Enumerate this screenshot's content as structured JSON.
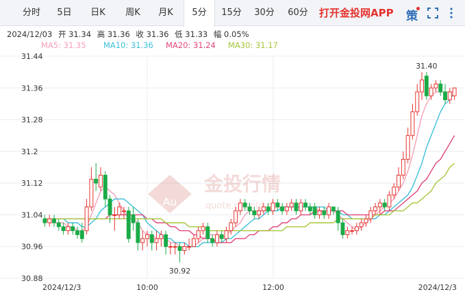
{
  "tabs": [
    {
      "label": "分时",
      "active": false
    },
    {
      "label": "5日",
      "active": false
    },
    {
      "label": "日K",
      "active": false
    },
    {
      "label": "周K",
      "active": false
    },
    {
      "label": "月K",
      "active": false
    },
    {
      "label": "5分",
      "active": true
    },
    {
      "label": "15分",
      "active": false
    },
    {
      "label": "30分",
      "active": false
    },
    {
      "label": "60分",
      "active": false
    }
  ],
  "app_link": "打开金投网APP",
  "toolbar": {
    "policy_label": "策"
  },
  "ohlc": {
    "date": "2024/12/03",
    "open": "开 31.34",
    "high": "高 31.36",
    "close": "收 31.36",
    "low": "低 31.33",
    "amplitude": "幅 0.05%"
  },
  "ma_legend": [
    {
      "label": "MA5: 31.35",
      "color": "#f5a0b8"
    },
    {
      "label": "MA10: 31.36",
      "color": "#3cbfd8"
    },
    {
      "label": "MA20: 31.24",
      "color": "#e0457b"
    },
    {
      "label": "MA30: 31.17",
      "color": "#a5c63b"
    }
  ],
  "colors": {
    "up": "#e5322d",
    "down": "#1bab47",
    "grid": "#e8ecf0"
  },
  "watermark": {
    "cn": "金投行情",
    "pinyin": "quote.cngold.org",
    "badge": "Au"
  },
  "chart_data": {
    "type": "candlestick",
    "title": "",
    "ylim": [
      30.88,
      31.44
    ],
    "y_ticks": [
      "31.44",
      "31.36",
      "31.28",
      "31.2",
      "31.12",
      "31.04",
      "30.96",
      "30.88"
    ],
    "x_labels": [
      "2024/12/3",
      "10:00",
      "12:00",
      "2024/12/3"
    ],
    "annotations": [
      {
        "text": "31.40",
        "index": 82,
        "value": 31.4
      },
      {
        "text": "30.92",
        "index": 29,
        "value": 30.92
      }
    ],
    "candles": [
      [
        31.03,
        31.02,
        31.04,
        31.01
      ],
      [
        31.02,
        31.03,
        31.04,
        31.01
      ],
      [
        31.03,
        31.02,
        31.04,
        31.01
      ],
      [
        31.02,
        31.01,
        31.03,
        31.0
      ],
      [
        31.01,
        31.0,
        31.02,
        30.99
      ],
      [
        31.0,
        31.01,
        31.02,
        30.99
      ],
      [
        31.01,
        31.0,
        31.02,
        30.99
      ],
      [
        31.0,
        30.99,
        31.01,
        30.98
      ],
      [
        31.0,
        30.98,
        31.02,
        30.97
      ],
      [
        31.0,
        31.06,
        31.08,
        30.99
      ],
      [
        31.06,
        31.13,
        31.16,
        31.05
      ],
      [
        31.13,
        31.12,
        31.17,
        31.1
      ],
      [
        31.11,
        31.14,
        31.16,
        31.1
      ],
      [
        31.14,
        31.08,
        31.15,
        31.06
      ],
      [
        31.08,
        31.04,
        31.09,
        31.02
      ],
      [
        31.04,
        31.04,
        31.06,
        31.0
      ],
      [
        31.04,
        31.06,
        31.07,
        31.03
      ],
      [
        31.05,
        31.05,
        31.06,
        31.03
      ],
      [
        31.05,
        30.98,
        31.06,
        30.97
      ],
      [
        31.04,
        31.02,
        31.06,
        31.0
      ],
      [
        31.02,
        30.97,
        31.03,
        30.95
      ],
      [
        30.97,
        30.98,
        31.0,
        30.95
      ],
      [
        30.98,
        30.99,
        31.0,
        30.96
      ],
      [
        30.99,
        30.97,
        31.0,
        30.95
      ],
      [
        30.97,
        30.98,
        31.0,
        30.95
      ],
      [
        30.98,
        30.99,
        31.0,
        30.96
      ],
      [
        30.99,
        30.96,
        31.0,
        30.94
      ],
      [
        30.96,
        30.96,
        30.97,
        30.94
      ],
      [
        30.96,
        30.96,
        30.97,
        30.94
      ],
      [
        30.96,
        30.95,
        30.97,
        30.92
      ],
      [
        30.95,
        30.96,
        30.97,
        30.94
      ],
      [
        30.96,
        30.96,
        30.98,
        30.95
      ],
      [
        30.96,
        30.98,
        30.99,
        30.96
      ],
      [
        30.98,
        31.0,
        31.01,
        30.97
      ],
      [
        31.0,
        31.01,
        31.02,
        30.99
      ],
      [
        31.01,
        30.98,
        31.02,
        30.97
      ],
      [
        30.98,
        30.97,
        30.99,
        30.96
      ],
      [
        30.97,
        30.99,
        31.0,
        30.96
      ],
      [
        30.99,
        30.98,
        31.0,
        30.97
      ],
      [
        30.98,
        31.0,
        31.01,
        30.97
      ],
      [
        31.0,
        31.02,
        31.03,
        30.99
      ],
      [
        31.02,
        31.05,
        31.06,
        31.01
      ],
      [
        31.05,
        31.07,
        31.08,
        31.04
      ],
      [
        31.07,
        31.06,
        31.08,
        31.05
      ],
      [
        31.06,
        31.05,
        31.07,
        31.04
      ],
      [
        31.05,
        31.04,
        31.06,
        31.03
      ],
      [
        31.04,
        31.05,
        31.06,
        31.03
      ],
      [
        31.05,
        31.06,
        31.07,
        31.04
      ],
      [
        31.06,
        31.05,
        31.07,
        31.04
      ],
      [
        31.05,
        31.07,
        31.08,
        31.04
      ],
      [
        31.07,
        31.06,
        31.08,
        31.05
      ],
      [
        31.06,
        31.05,
        31.07,
        31.04
      ],
      [
        31.05,
        31.06,
        31.07,
        31.04
      ],
      [
        31.06,
        31.07,
        31.08,
        31.05
      ],
      [
        31.07,
        31.05,
        31.08,
        31.04
      ],
      [
        31.05,
        31.07,
        31.08,
        31.04
      ],
      [
        31.07,
        31.06,
        31.08,
        31.05
      ],
      [
        31.06,
        31.05,
        31.07,
        31.04
      ],
      [
        31.06,
        31.04,
        31.07,
        31.03
      ],
      [
        31.04,
        31.05,
        31.06,
        31.03
      ],
      [
        31.05,
        31.04,
        31.06,
        31.03
      ],
      [
        31.04,
        31.06,
        31.07,
        31.03
      ],
      [
        31.06,
        31.05,
        31.06,
        31.04
      ],
      [
        31.05,
        31.02,
        31.06,
        31.0
      ],
      [
        31.02,
        30.99,
        31.03,
        30.98
      ],
      [
        30.99,
        31.0,
        31.01,
        30.98
      ],
      [
        31.0,
        31.0,
        31.01,
        30.99
      ],
      [
        31.0,
        31.01,
        31.02,
        30.99
      ],
      [
        31.01,
        31.02,
        31.03,
        31.0
      ],
      [
        31.02,
        31.03,
        31.04,
        31.01
      ],
      [
        31.03,
        31.05,
        31.06,
        31.02
      ],
      [
        31.05,
        31.06,
        31.07,
        31.04
      ],
      [
        31.06,
        31.07,
        31.08,
        31.04
      ],
      [
        31.07,
        31.06,
        31.08,
        31.05
      ],
      [
        31.06,
        31.09,
        31.1,
        31.05
      ],
      [
        31.09,
        31.11,
        31.12,
        31.08
      ],
      [
        31.11,
        31.14,
        31.16,
        31.1
      ],
      [
        31.14,
        31.18,
        31.2,
        31.13
      ],
      [
        31.18,
        31.24,
        31.26,
        31.17
      ],
      [
        31.24,
        31.3,
        31.32,
        31.23
      ],
      [
        31.3,
        31.35,
        31.37,
        31.29
      ],
      [
        31.35,
        31.38,
        31.4,
        31.33
      ],
      [
        31.39,
        31.34,
        31.4,
        31.33
      ],
      [
        31.34,
        31.36,
        31.37,
        31.33
      ],
      [
        31.36,
        31.37,
        31.38,
        31.35
      ],
      [
        31.37,
        31.35,
        31.38,
        31.34
      ],
      [
        31.35,
        31.33,
        31.37,
        31.32
      ],
      [
        31.33,
        31.35,
        31.36,
        31.32
      ],
      [
        31.34,
        31.36,
        31.36,
        31.33
      ]
    ],
    "ma5": [
      31.03,
      31.02,
      31.02,
      31.02,
      31.02,
      31.01,
      31.01,
      31.0,
      31.0,
      31.01,
      31.04,
      31.07,
      31.1,
      31.11,
      31.1,
      31.09,
      31.07,
      31.05,
      31.03,
      31.03,
      31.02,
      31.0,
      30.99,
      30.99,
      30.98,
      30.98,
      30.98,
      30.97,
      30.97,
      30.96,
      30.96,
      30.96,
      30.96,
      30.97,
      30.98,
      30.99,
      30.99,
      30.99,
      30.98,
      30.99,
      31.0,
      31.01,
      31.02,
      31.04,
      31.05,
      31.05,
      31.05,
      31.05,
      31.05,
      31.06,
      31.06,
      31.06,
      31.06,
      31.06,
      31.06,
      31.06,
      31.06,
      31.06,
      31.06,
      31.05,
      31.05,
      31.05,
      31.05,
      31.04,
      31.03,
      31.02,
      31.01,
      31.0,
      31.01,
      31.02,
      31.03,
      31.04,
      31.05,
      31.06,
      31.07,
      31.08,
      31.1,
      31.12,
      31.15,
      31.19,
      31.24,
      31.29,
      31.32,
      31.34,
      31.35,
      31.35,
      31.35,
      31.35,
      31.35
    ],
    "ma10": [
      31.03,
      31.03,
      31.03,
      31.03,
      31.03,
      31.02,
      31.02,
      31.02,
      31.01,
      31.01,
      31.02,
      31.03,
      31.05,
      31.06,
      31.07,
      31.08,
      31.08,
      31.08,
      31.07,
      31.06,
      31.05,
      31.04,
      31.02,
      31.01,
      31.0,
      30.99,
      30.98,
      30.98,
      30.97,
      30.97,
      30.97,
      30.96,
      30.96,
      30.96,
      30.97,
      30.97,
      30.97,
      30.97,
      30.97,
      30.98,
      30.98,
      30.99,
      31.0,
      31.01,
      31.02,
      31.03,
      31.03,
      31.04,
      31.05,
      31.05,
      31.05,
      31.06,
      31.06,
      31.06,
      31.06,
      31.06,
      31.06,
      31.06,
      31.06,
      31.06,
      31.06,
      31.05,
      31.05,
      31.05,
      31.04,
      31.04,
      31.03,
      31.03,
      31.03,
      31.03,
      31.03,
      31.03,
      31.04,
      31.04,
      31.05,
      31.06,
      31.07,
      31.08,
      31.09,
      31.11,
      31.14,
      31.17,
      31.21,
      31.24,
      31.27,
      31.3,
      31.32,
      31.33,
      31.35
    ],
    "ma20": [
      31.03,
      31.03,
      31.03,
      31.03,
      31.03,
      31.03,
      31.03,
      31.03,
      31.03,
      31.03,
      31.03,
      31.03,
      31.03,
      31.03,
      31.04,
      31.04,
      31.04,
      31.04,
      31.04,
      31.04,
      31.04,
      31.04,
      31.03,
      31.03,
      31.02,
      31.02,
      31.02,
      31.01,
      31.01,
      31.0,
      31.0,
      31.0,
      30.99,
      30.99,
      30.98,
      30.98,
      30.98,
      30.97,
      30.97,
      30.97,
      30.97,
      30.98,
      30.98,
      30.98,
      30.99,
      30.99,
      31.0,
      31.0,
      31.0,
      31.01,
      31.01,
      31.02,
      31.02,
      31.03,
      31.03,
      31.04,
      31.04,
      31.04,
      31.05,
      31.05,
      31.05,
      31.05,
      31.05,
      31.05,
      31.05,
      31.04,
      31.04,
      31.04,
      31.04,
      31.04,
      31.04,
      31.04,
      31.04,
      31.05,
      31.05,
      31.05,
      31.06,
      31.07,
      31.08,
      31.09,
      31.1,
      31.12,
      31.13,
      31.15,
      31.17,
      31.18,
      31.2,
      31.22,
      31.24
    ],
    "ma30": [
      31.03,
      31.03,
      31.03,
      31.03,
      31.03,
      31.03,
      31.03,
      31.03,
      31.03,
      31.03,
      31.03,
      31.03,
      31.03,
      31.03,
      31.03,
      31.03,
      31.03,
      31.03,
      31.03,
      31.03,
      31.03,
      31.03,
      31.03,
      31.03,
      31.03,
      31.03,
      31.02,
      31.02,
      31.02,
      31.02,
      31.02,
      31.01,
      31.01,
      31.01,
      31.01,
      31.0,
      31.0,
      31.0,
      31.0,
      31.0,
      31.0,
      31.0,
      31.0,
      31.0,
      31.0,
      31.0,
      31.0,
      31.0,
      31.0,
      31.0,
      31.0,
      31.0,
      31.01,
      31.01,
      31.01,
      31.01,
      31.01,
      31.02,
      31.02,
      31.02,
      31.02,
      31.02,
      31.02,
      31.03,
      31.03,
      31.03,
      31.03,
      31.03,
      31.03,
      31.03,
      31.03,
      31.04,
      31.04,
      31.04,
      31.04,
      31.05,
      31.05,
      31.05,
      31.06,
      31.07,
      31.07,
      31.08,
      31.09,
      31.1,
      31.12,
      31.13,
      31.14,
      31.16,
      31.17
    ]
  }
}
